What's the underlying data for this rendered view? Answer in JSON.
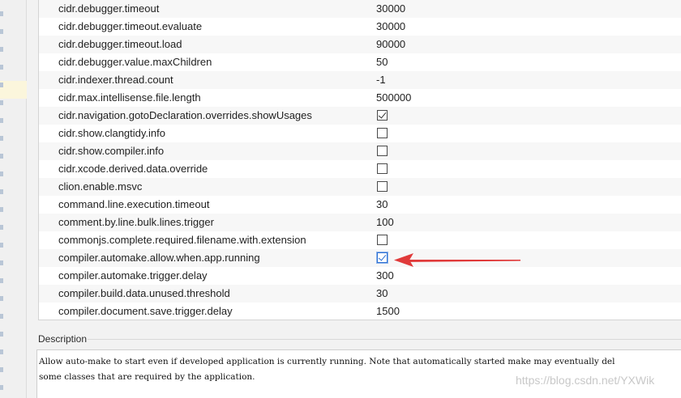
{
  "registry": {
    "rows": [
      {
        "key": "cidr.debugger.timeout",
        "type": "text",
        "value": "30000"
      },
      {
        "key": "cidr.debugger.timeout.evaluate",
        "type": "text",
        "value": "30000"
      },
      {
        "key": "cidr.debugger.timeout.load",
        "type": "text",
        "value": "90000"
      },
      {
        "key": "cidr.debugger.value.maxChildren",
        "type": "text",
        "value": "50"
      },
      {
        "key": "cidr.indexer.thread.count",
        "type": "text",
        "value": "-1"
      },
      {
        "key": "cidr.max.intellisense.file.length",
        "type": "text",
        "value": "500000"
      },
      {
        "key": "cidr.navigation.gotoDeclaration.overrides.showUsages",
        "type": "checkbox",
        "checked": true
      },
      {
        "key": "cidr.show.clangtidy.info",
        "type": "checkbox",
        "checked": false
      },
      {
        "key": "cidr.show.compiler.info",
        "type": "checkbox",
        "checked": false
      },
      {
        "key": "cidr.xcode.derived.data.override",
        "type": "checkbox",
        "checked": false
      },
      {
        "key": "clion.enable.msvc",
        "type": "checkbox",
        "checked": false
      },
      {
        "key": "command.line.execution.timeout",
        "type": "text",
        "value": "30"
      },
      {
        "key": "comment.by.line.bulk.lines.trigger",
        "type": "text",
        "value": "100"
      },
      {
        "key": "commonjs.complete.required.filename.with.extension",
        "type": "checkbox",
        "checked": false
      },
      {
        "key": "compiler.automake.allow.when.app.running",
        "type": "checkbox",
        "checked": true,
        "focused": true
      },
      {
        "key": "compiler.automake.trigger.delay",
        "type": "text",
        "value": "300"
      },
      {
        "key": "compiler.build.data.unused.threshold",
        "type": "text",
        "value": "30"
      },
      {
        "key": "compiler.document.save.trigger.delay",
        "type": "text",
        "value": "1500"
      }
    ]
  },
  "description": {
    "label": "Description",
    "text": "Allow auto-make to start even if developed application is currently running. Note that automatically started make may eventually del\nsome classes that are required by the application."
  },
  "watermark": "https://blog.csdn.net/YXWik",
  "colors": {
    "arrow": "#e03a3a",
    "checkbox_focus": "#2c6fd1"
  }
}
